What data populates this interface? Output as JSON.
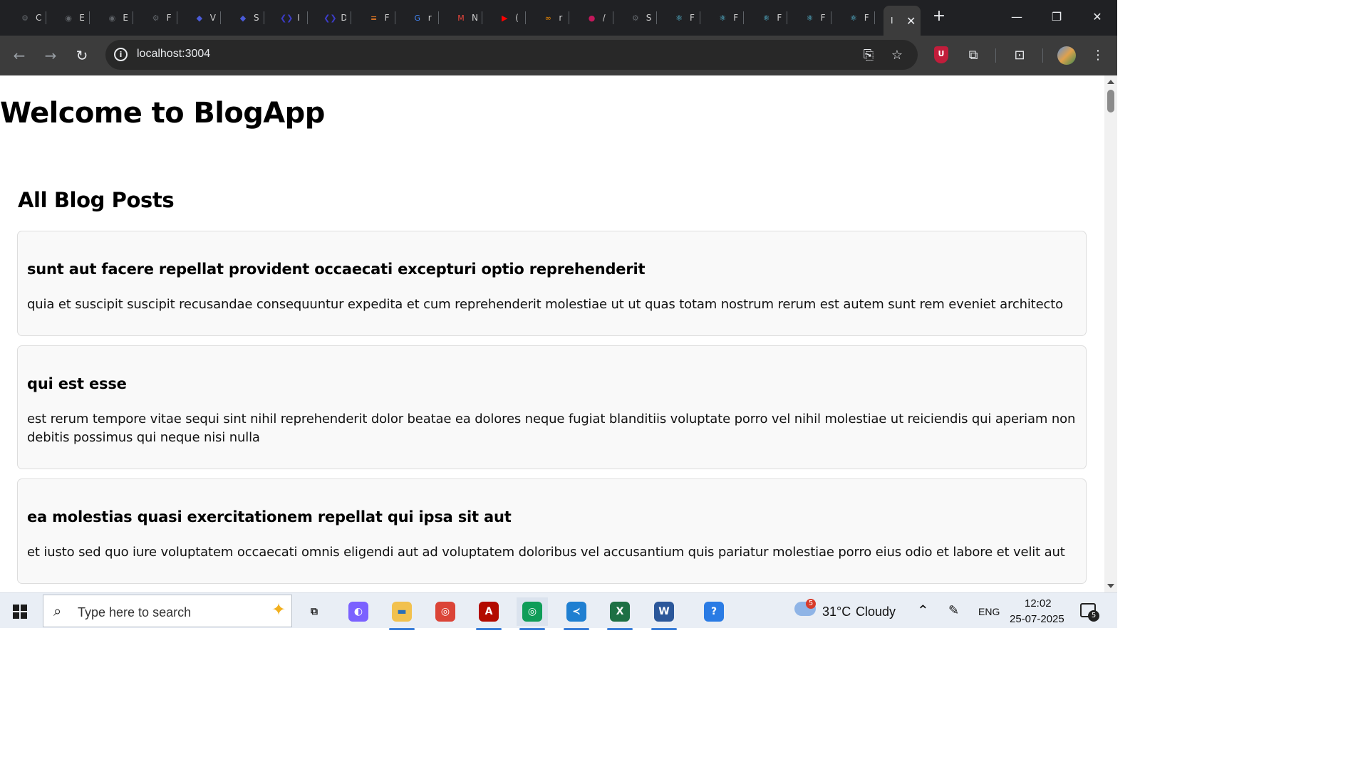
{
  "browser": {
    "tabs": [
      {
        "icon": "openai-icon",
        "glyph": "⚙",
        "color": "#5f6368",
        "title": "C"
      },
      {
        "icon": "globe-icon",
        "glyph": "◉",
        "color": "#5f6368",
        "title": "E"
      },
      {
        "icon": "globe-icon",
        "glyph": "◉",
        "color": "#5f6368",
        "title": "E"
      },
      {
        "icon": "openai-icon",
        "glyph": "⚙",
        "color": "#5f6368",
        "title": "F"
      },
      {
        "icon": "cube-icon",
        "glyph": "◆",
        "color": "#4a5bd8",
        "title": "V"
      },
      {
        "icon": "cube-icon",
        "glyph": "◆",
        "color": "#4a5bd8",
        "title": "S"
      },
      {
        "icon": "code-icon",
        "glyph": "❮❯",
        "color": "#3c3cc8",
        "title": "I"
      },
      {
        "icon": "code-icon",
        "glyph": "❮❯",
        "color": "#3c3cc8",
        "title": "D"
      },
      {
        "icon": "stack-icon",
        "glyph": "≡",
        "color": "#f48024",
        "title": "F"
      },
      {
        "icon": "google-icon",
        "glyph": "G",
        "color": "#4285f4",
        "title": "r"
      },
      {
        "icon": "m-logo-icon",
        "glyph": "M",
        "color": "#e8453c",
        "title": "N"
      },
      {
        "icon": "youtube-icon",
        "glyph": "▶",
        "color": "#ff0000",
        "title": "("
      },
      {
        "icon": "infinity-icon",
        "glyph": "∞",
        "color": "#f28b00",
        "title": "r"
      },
      {
        "icon": "record-icon",
        "glyph": "●",
        "color": "#c2185b",
        "title": "/"
      },
      {
        "icon": "openai-icon",
        "glyph": "⚙",
        "color": "#5f6368",
        "title": "S"
      },
      {
        "icon": "react-icon",
        "glyph": "⚛",
        "color": "#61dafb",
        "title": "F"
      },
      {
        "icon": "react-icon",
        "glyph": "⚛",
        "color": "#61dafb",
        "title": "F"
      },
      {
        "icon": "react-icon",
        "glyph": "⚛",
        "color": "#61dafb",
        "title": "F"
      },
      {
        "icon": "react-icon",
        "glyph": "⚛",
        "color": "#61dafb",
        "title": "F"
      },
      {
        "icon": "react-icon",
        "glyph": "⚛",
        "color": "#61dafb",
        "title": "F"
      }
    ],
    "active_tab": {
      "title": "I",
      "close": "✕"
    },
    "new_tab": "+",
    "window_controls": {
      "minimize": "—",
      "restore": "❐",
      "close": "✕"
    },
    "nav": {
      "back": "←",
      "forward": "→",
      "reload": "↻"
    },
    "address": {
      "info": "i",
      "url": "localhost:3004"
    },
    "toolbar_icons": {
      "install": "⎘",
      "bookmark": "☆",
      "ublock": "U",
      "extensions": "⧉",
      "reading": "⊡",
      "menu": "⋮"
    }
  },
  "page": {
    "title": "Welcome to BlogApp",
    "section_title": "All Blog Posts",
    "posts": [
      {
        "title": "sunt aut facere repellat provident occaecati excepturi optio reprehenderit",
        "body": "quia et suscipit suscipit recusandae consequuntur expedita et cum reprehenderit molestiae ut ut quas totam nostrum rerum est autem sunt rem eveniet architecto"
      },
      {
        "title": "qui est esse",
        "body": "est rerum tempore vitae sequi sint nihil reprehenderit dolor beatae ea dolores neque fugiat blanditiis voluptate porro vel nihil molestiae ut reiciendis qui aperiam non debitis possimus qui neque nisi nulla"
      },
      {
        "title": "ea molestias quasi exercitationem repellat qui ipsa sit aut",
        "body": "et iusto sed quo iure voluptatem occaecati omnis eligendi aut ad voluptatem doloribus vel accusantium quis pariatur molestiae porro eius odio et labore et velit aut"
      }
    ]
  },
  "taskbar": {
    "search_placeholder": "Type here to search",
    "apps": [
      {
        "name": "task-view-app",
        "glyph": "⧉",
        "bg": "transparent",
        "fg": "#222",
        "running": false
      },
      {
        "name": "copilot-app",
        "glyph": "◐",
        "bg": "#7b61ff",
        "fg": "#fff",
        "running": false
      },
      {
        "name": "file-explorer-app",
        "glyph": "▬",
        "bg": "#f2c14e",
        "fg": "#2a6fb8",
        "running": true
      },
      {
        "name": "chrome-app",
        "glyph": "◎",
        "bg": "#db4437",
        "fg": "#fff",
        "running": false
      },
      {
        "name": "acrobat-app",
        "glyph": "A",
        "bg": "#b30b00",
        "fg": "#fff",
        "running": true
      },
      {
        "name": "chrome-profile-app",
        "glyph": "◎",
        "bg": "#0f9d58",
        "fg": "#fff",
        "running": true
      },
      {
        "name": "vscode-app",
        "glyph": "≺",
        "bg": "#1f7fd1",
        "fg": "#fff",
        "running": true
      },
      {
        "name": "excel-app",
        "glyph": "X",
        "bg": "#1d7044",
        "fg": "#fff",
        "running": true
      },
      {
        "name": "word-app",
        "glyph": "W",
        "bg": "#2b579a",
        "fg": "#fff",
        "running": true
      },
      {
        "name": "help-app",
        "glyph": "?",
        "bg": "#2a7be4",
        "fg": "#fff",
        "running": false
      }
    ],
    "weather": {
      "badge": "5",
      "temp": "31°C",
      "condition": "Cloudy"
    },
    "tray": {
      "chevron": "⌃",
      "pen": "✎",
      "language": "ENG"
    },
    "clock": {
      "time": "12:02",
      "date": "25-07-2025"
    },
    "notifications": "5"
  }
}
